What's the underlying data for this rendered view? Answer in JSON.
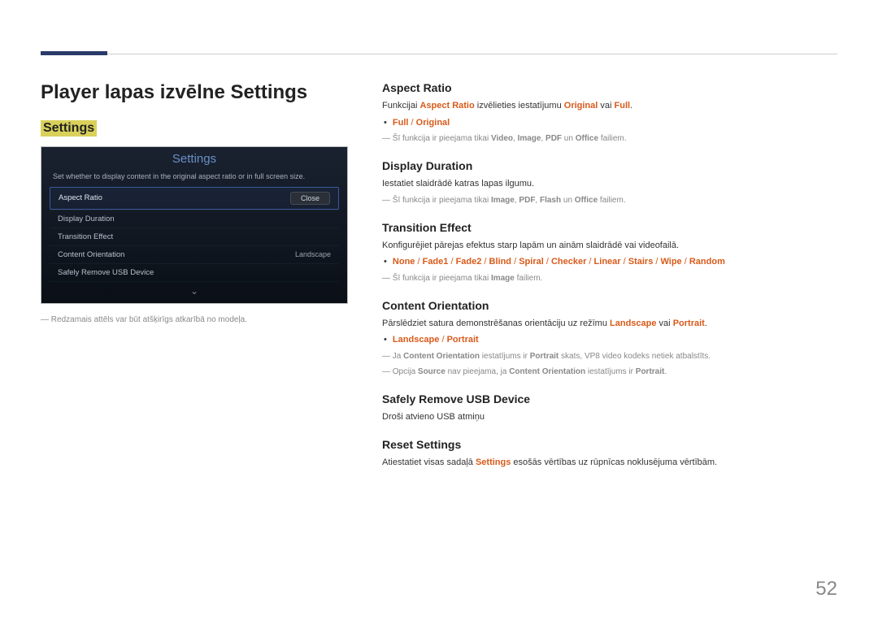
{
  "page_title": "Player lapas izvēlne Settings",
  "left": {
    "heading": "Settings",
    "mock": {
      "title": "Settings",
      "desc": "Set whether to display content in the original aspect ratio or in full screen size.",
      "rows": [
        {
          "label": "Aspect Ratio",
          "value": "",
          "close": "Close",
          "selected": true
        },
        {
          "label": "Display Duration",
          "value": ""
        },
        {
          "label": "Transition Effect",
          "value": ""
        },
        {
          "label": "Content Orientation",
          "value": "Landscape"
        },
        {
          "label": "Safely Remove USB Device",
          "value": ""
        }
      ]
    },
    "note": "Redzamais attēls var būt atšķirīgs atkarībā no modeļa."
  },
  "sections": {
    "aspect_ratio": {
      "title": "Aspect Ratio",
      "p1_a": "Funkcijai ",
      "p1_b": "Aspect Ratio",
      "p1_c": " izvēlieties iestatījumu ",
      "p1_d": "Original",
      "p1_e": " vai ",
      "p1_f": "Full",
      "p1_g": ".",
      "bullet": {
        "a": "Full",
        "sep": " / ",
        "b": "Original"
      },
      "note_a": "Šī funkcija ir pieejama tikai ",
      "note_b": "Video",
      "note_c": ", ",
      "note_d": "Image",
      "note_e": ", ",
      "note_f": "PDF",
      "note_g": " un ",
      "note_h": "Office",
      "note_i": " failiem."
    },
    "display_duration": {
      "title": "Display Duration",
      "p1": "Iestatiet slaidrādē katras lapas ilgumu.",
      "note_a": "Šī funkcija ir pieejama tikai ",
      "note_b": "Image",
      "note_c": ", ",
      "note_d": "PDF",
      "note_e": ", ",
      "note_f": "Flash",
      "note_g": " un ",
      "note_h": "Office",
      "note_i": " failiem."
    },
    "transition_effect": {
      "title": "Transition Effect",
      "p1": "Konfigurējiet pārejas efektus starp lapām un ainām slaidrādē vai videofailā.",
      "opts": [
        "None",
        "Fade1",
        "Fade2",
        "Blind",
        "Spiral",
        "Checker",
        "Linear",
        "Stairs",
        "Wipe",
        "Random"
      ],
      "sep": " / ",
      "note_a": "Šī funkcija ir pieejama tikai ",
      "note_b": "Image",
      "note_c": " failiem."
    },
    "content_orientation": {
      "title": "Content Orientation",
      "p1_a": "Pārslēdziet satura demonstrēšanas orientāciju uz režīmu ",
      "p1_b": "Landscape",
      "p1_c": " vai ",
      "p1_d": "Portrait",
      "p1_e": ".",
      "bullet": {
        "a": "Landscape",
        "sep": " / ",
        "b": "Portrait"
      },
      "note1_a": "Ja ",
      "note1_b": "Content Orientation",
      "note1_c": " iestatījums ir ",
      "note1_d": "Portrait",
      "note1_e": " skats, VP8 video kodeks netiek atbalstīts.",
      "note2_a": "Opcija ",
      "note2_b": "Source",
      "note2_c": " nav pieejama, ja ",
      "note2_d": "Content Orientation",
      "note2_e": " iestatījums ir ",
      "note2_f": "Portrait",
      "note2_g": "."
    },
    "safely_remove": {
      "title": "Safely Remove USB Device",
      "p1": "Droši atvieno USB atmiņu"
    },
    "reset": {
      "title": "Reset Settings",
      "p1_a": "Atiestatiet visas sadaļā ",
      "p1_b": "Settings",
      "p1_c": " esošās vērtības uz rūpnīcas noklusējuma vērtībām."
    }
  },
  "page_number": "52"
}
